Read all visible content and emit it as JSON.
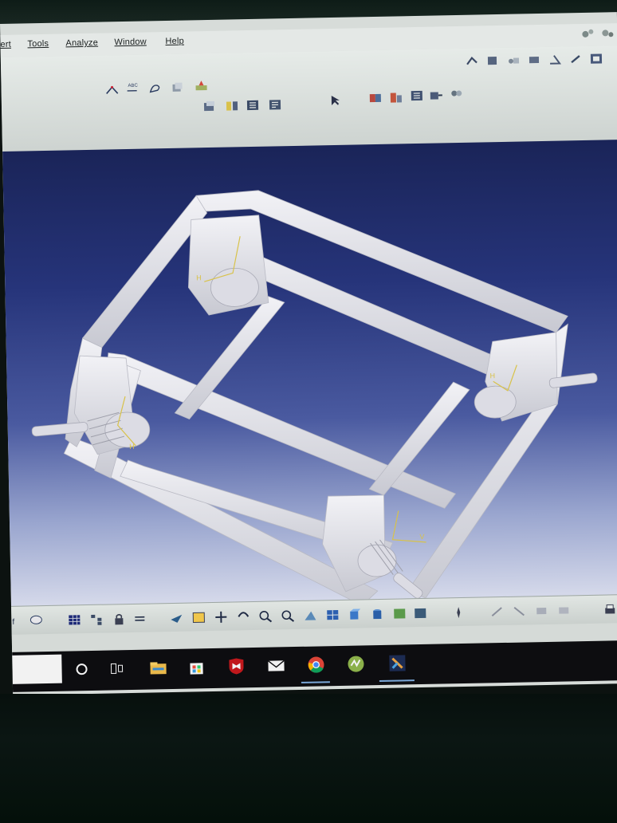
{
  "menu": {
    "items": [
      {
        "label": "ert"
      },
      {
        "label": "Tools"
      },
      {
        "label": "Analyze"
      },
      {
        "label": "Window"
      },
      {
        "label": "Help"
      }
    ]
  },
  "toolbar": {
    "annotation_text_icon_label": "ABC"
  },
  "model": {
    "axis_label_h": "H",
    "axis_label_v": "V"
  },
  "taskbar": {
    "items": [
      {
        "icon": "cortana-circle-icon"
      },
      {
        "icon": "task-view-icon"
      },
      {
        "icon": "file-explorer-icon"
      },
      {
        "icon": "store-icon"
      },
      {
        "icon": "mcafee-icon"
      },
      {
        "icon": "mail-icon"
      },
      {
        "icon": "chrome-icon"
      },
      {
        "icon": "green-app-icon"
      },
      {
        "icon": "catia-app-icon"
      }
    ]
  },
  "colors": {
    "viewport_top": "#1a2458",
    "viewport_bottom": "#d5d9ea",
    "model_fill": "#e6e6ec",
    "constraint_yellow": "#d8c24a"
  }
}
